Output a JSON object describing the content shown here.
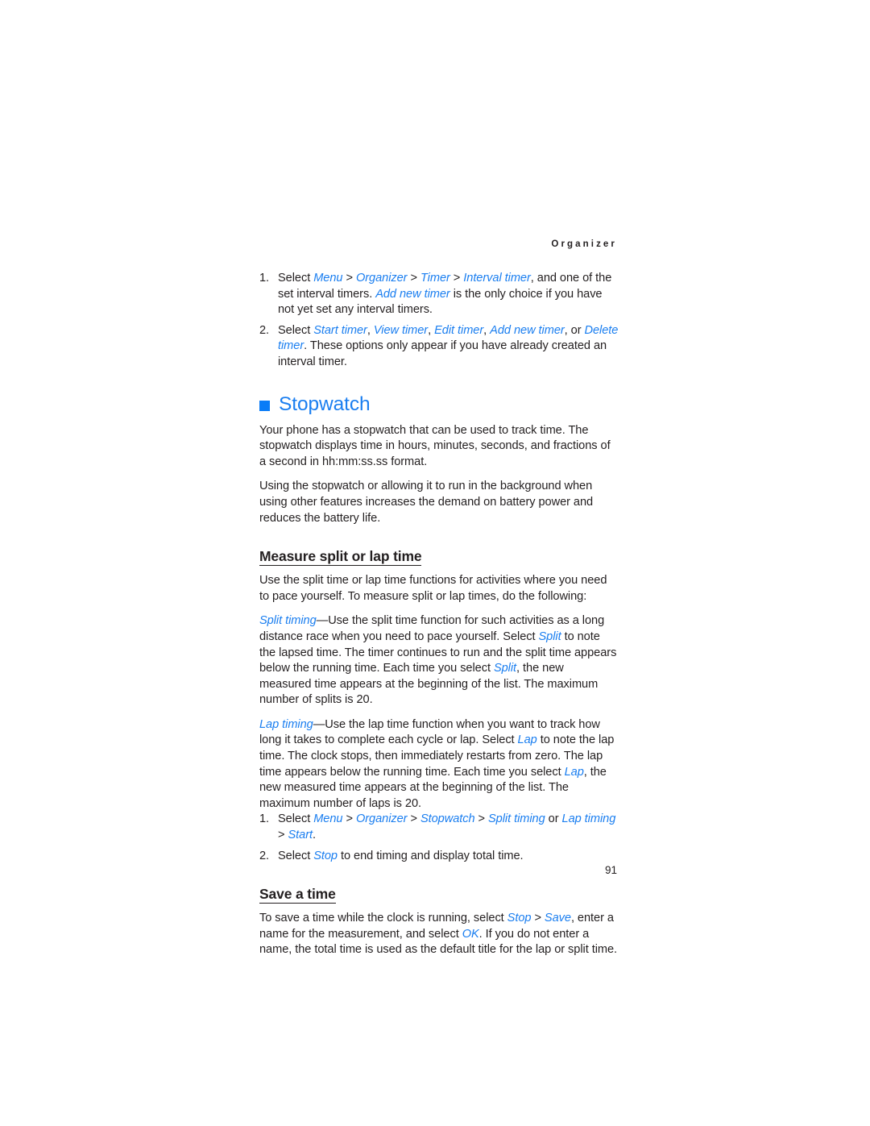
{
  "page": {
    "running_head": "Organizer",
    "folio": "91",
    "accent_blue": "#1a7ef0",
    "bullet_blue": "#0a7cf7",
    "text_color": "#231f20",
    "background": "#ffffff"
  },
  "interval_timer_steps": {
    "step1": {
      "number": "1.",
      "lead": "Select ",
      "t1": "Menu",
      "s1": " > ",
      "t2": "Organizer",
      "s2": " > ",
      "t3": "Timer",
      "s3": " > ",
      "t4": "Interval timer",
      "mid": ", and one of the set interval timers. ",
      "t5": "Add new timer",
      "tail": " is the only choice if you have not yet set any interval timers."
    },
    "step2": {
      "number": "2.",
      "lead": "Select ",
      "t1": "Start timer",
      "s1": ", ",
      "t2": "View timer",
      "s2": ", ",
      "t3": "Edit timer",
      "s3": ", ",
      "t4": "Add new timer",
      "s4": ", or ",
      "t5": "Delete timer",
      "tail": ". These options only appear if you have already created an interval timer."
    }
  },
  "stopwatch": {
    "heading": "Stopwatch",
    "bullet_icon": "blue-square-icon",
    "intro_para1": "Your phone has a stopwatch that can be used to track time. The stopwatch displays time in hours, minutes, seconds, and fractions of a second in hh:mm:ss.ss format.",
    "intro_para2": "Using the stopwatch or allowing it to run in the background when using other features increases the demand on battery power and reduces the battery life.",
    "measure_section": {
      "heading": "Measure split or lap time",
      "intro": "Use the split time or lap time functions for activities where you need to pace yourself. To measure split or lap times, do the following:",
      "split_timing": {
        "term": "Split timing",
        "part1": "—Use the split time function for such activities as a long distance race when you need to pace yourself. Select ",
        "t1": "Split",
        "part2": " to note the lapsed time. The timer continues to run and the split time appears below the running time. Each time you select ",
        "t2": "Split",
        "part3": ", the new measured time appears at the beginning of the list. The maximum number of splits is 20."
      },
      "lap_timing": {
        "term": "Lap timing",
        "part1": "—Use the lap time function when you want to track how long it takes to complete each cycle or lap. Select ",
        "t1": "Lap",
        "part2": " to note the lap time. The clock stops, then immediately restarts from zero. The lap time appears below the running time. Each time you select ",
        "t2": "Lap",
        "part3": ", the new measured time appears at the beginning of the list. The maximum number of laps is 20."
      },
      "steps": {
        "step1": {
          "number": "1.",
          "lead": "Select ",
          "t1": "Menu",
          "s1": " > ",
          "t2": "Organizer",
          "s2": " > ",
          "t3": "Stopwatch",
          "s3": " > ",
          "t4": "Split timing",
          "s4": " or ",
          "t5": "Lap timing",
          "s5": " > ",
          "t6": "Start",
          "tail": "."
        },
        "step2": {
          "number": "2.",
          "lead": "Select ",
          "t1": "Stop",
          "tail": " to end timing and display total time."
        }
      }
    },
    "save_section": {
      "heading": "Save a time",
      "lead": "To save a time while the clock is running, select ",
      "t1": "Stop",
      "s1": " > ",
      "t2": "Save",
      "mid": ", enter a name for the measurement, and select ",
      "t3": "OK",
      "tail": ". If you do not enter a name, the total time is used as the default title for the lap or split time."
    }
  }
}
